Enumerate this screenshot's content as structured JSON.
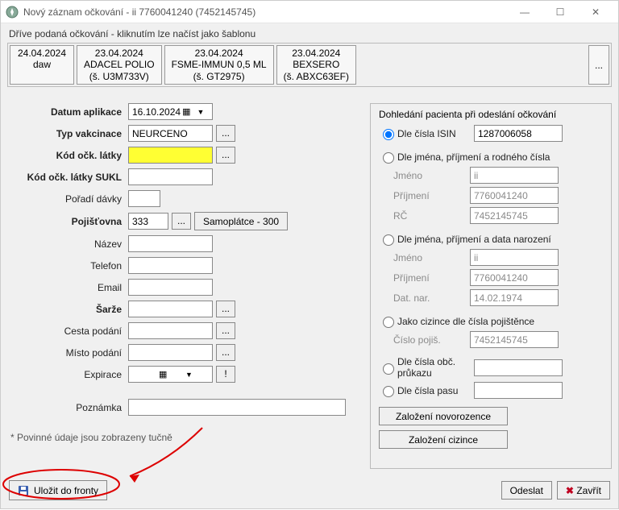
{
  "window": {
    "title": "Nový záznam očkování - ii 7760041240 (7452145745)"
  },
  "templates": {
    "label": "Dříve podaná očkování - kliknutím lze načíst jako šablonu",
    "items": [
      {
        "line1": "24.04.2024",
        "line2": "daw",
        "line3": ""
      },
      {
        "line1": "23.04.2024",
        "line2": "ADACEL POLIO",
        "line3": "(š. U3M733V)"
      },
      {
        "line1": "23.04.2024",
        "line2": "FSME-IMMUN 0,5 ML",
        "line3": "(š. GT2975)"
      },
      {
        "line1": "23.04.2024",
        "line2": "BEXSERO",
        "line3": "(š. ABXC63EF)"
      }
    ],
    "more": "..."
  },
  "form": {
    "datum_aplikace_label": "Datum aplikace",
    "datum_aplikace_value": "16.10.2024",
    "typ_vakcinace_label": "Typ vakcinace",
    "typ_vakcinace_value": "NEURCENO",
    "kod_ock_latky_label": "Kód očk. látky",
    "kod_ock_latky_value": "",
    "kod_ock_latky_sukl_label": "Kód očk. látky SUKL",
    "kod_ock_latky_sukl_value": "",
    "poradi_davky_label": "Pořadí dávky",
    "poradi_davky_value": "",
    "pojistovna_label": "Pojišťovna",
    "pojistovna_value": "333",
    "samoplatce_label": "Samoplátce - 300",
    "nazev_label": "Název",
    "nazev_value": "",
    "telefon_label": "Telefon",
    "telefon_value": "",
    "email_label": "Email",
    "email_value": "",
    "sarze_label": "Šarže",
    "sarze_value": "",
    "cesta_podani_label": "Cesta podání",
    "cesta_podani_value": "",
    "misto_podani_label": "Místo podání",
    "misto_podani_value": "",
    "expirace_label": "Expirace",
    "expirace_value": "",
    "poznamka_label": "Poznámka",
    "poznamka_value": "",
    "footnote": "* Povinné údaje jsou zobrazeny tučně",
    "ellipses": "...",
    "exclaim": "!"
  },
  "lookup": {
    "heading": "Dohledání pacienta při odeslání očkování",
    "isin_label": "Dle čísla ISIN",
    "isin_value": "1287006058",
    "jprc_label": "Dle jména, příjmení a rodného čísla",
    "jmeno_label": "Jméno",
    "prijmeni_label": "Příjmení",
    "rc_label": "RČ",
    "jmeno_value": "ii",
    "prijmeni_value": "7760041240",
    "rc_value": "7452145745",
    "jpdn_label": "Dle jména, příjmení a data narození",
    "datnar_label": "Dat. nar.",
    "datnar_value": "14.02.1974",
    "cizinec_label": "Jako cizince dle čísla pojištěnce",
    "cislo_pojis_label": "Číslo pojiš.",
    "cislo_pojis_value": "7452145745",
    "obc_prukaz_label": "Dle čísla obč. průkazu",
    "obc_prukaz_value": "",
    "pas_label": "Dle čísla pasu",
    "pas_value": "",
    "btn_novorozenec": "Založení novorozence",
    "btn_cizinec": "Založení cizince"
  },
  "footer": {
    "save": "Uložit do fronty",
    "send": "Odeslat",
    "close": "Zavřít"
  }
}
